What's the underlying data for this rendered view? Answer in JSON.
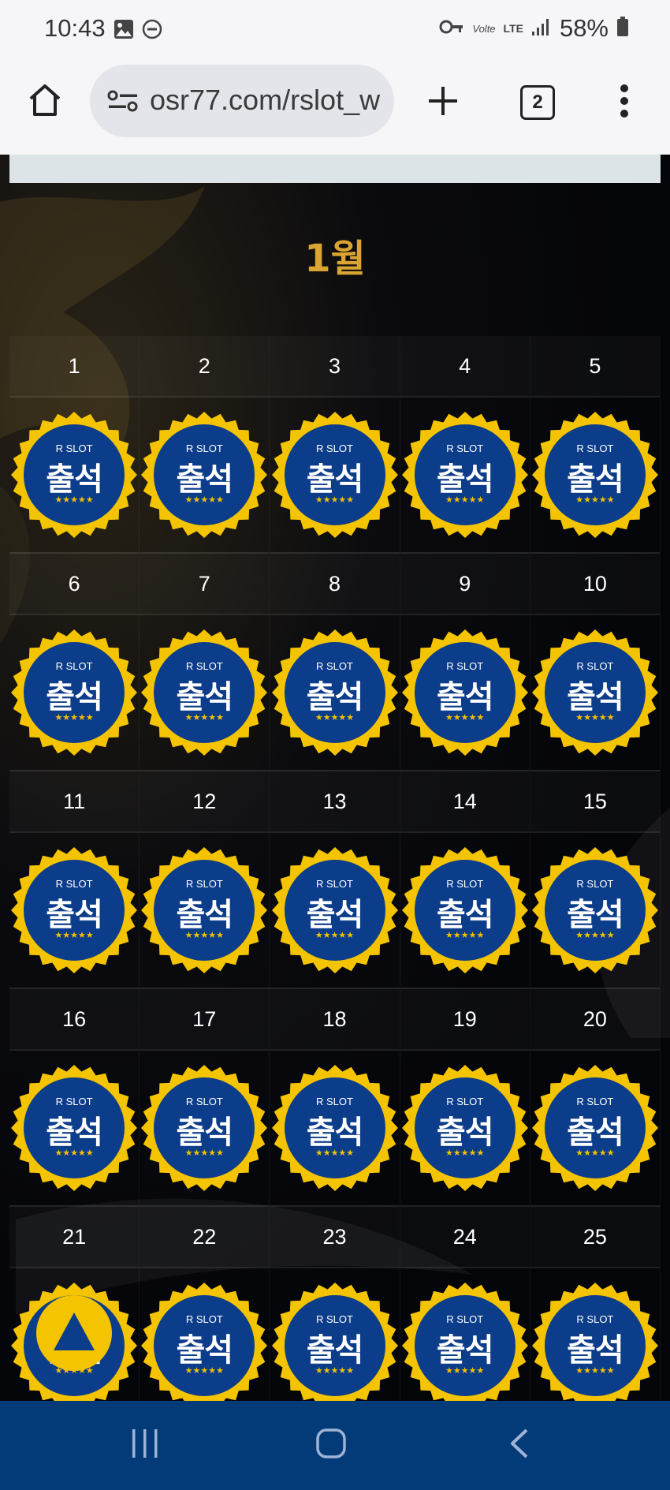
{
  "status_bar": {
    "time": "10:43",
    "network": "LTE",
    "volte": "Volte",
    "battery": "58%"
  },
  "browser": {
    "url": "osr77.com/rslot_w",
    "tab_count": "2"
  },
  "calendar": {
    "month": "1월",
    "badge_brand": "R SLOT",
    "badge_label": "출석",
    "badge_stars": "★★★★★",
    "weeks": [
      [
        "1",
        "2",
        "3",
        "4",
        "5"
      ],
      [
        "6",
        "7",
        "8",
        "9",
        "10"
      ],
      [
        "11",
        "12",
        "13",
        "14",
        "15"
      ],
      [
        "16",
        "17",
        "18",
        "19",
        "20"
      ],
      [
        "21",
        "22",
        "23",
        "24",
        "25"
      ]
    ]
  },
  "colors": {
    "accent_gold": "#d9a431",
    "badge_blue": "#0c3d8a",
    "badge_yellow": "#f5c400",
    "nav_blue": "#033b78"
  }
}
